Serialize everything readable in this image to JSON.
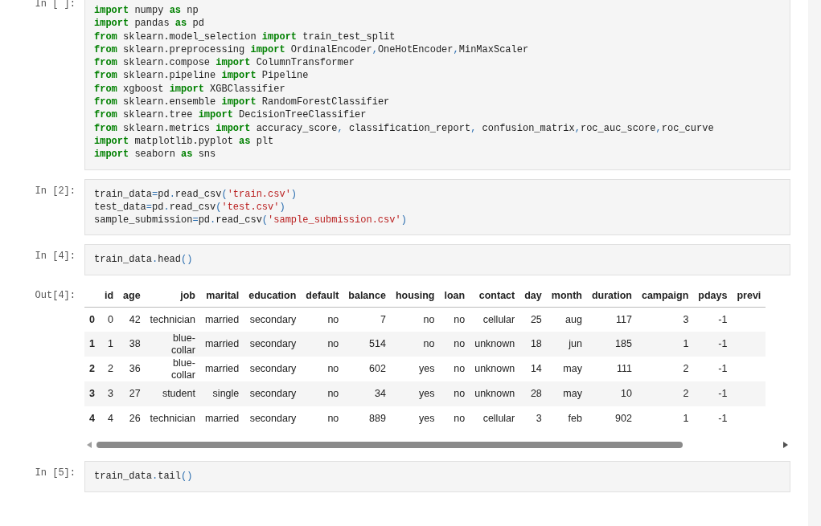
{
  "cells": [
    {
      "prompt": "In [ ]:",
      "lines": [
        [
          {
            "kind": "kw",
            "text": "import"
          },
          {
            "kind": "plain",
            "text": " numpy "
          },
          {
            "kind": "kw",
            "text": "as"
          },
          {
            "kind": "plain",
            "text": " np"
          }
        ],
        [
          {
            "kind": "kw",
            "text": "import"
          },
          {
            "kind": "plain",
            "text": " pandas "
          },
          {
            "kind": "kw",
            "text": "as"
          },
          {
            "kind": "plain",
            "text": " pd"
          }
        ],
        [
          {
            "kind": "kw",
            "text": "from"
          },
          {
            "kind": "plain",
            "text": " sklearn.model_selection "
          },
          {
            "kind": "kw",
            "text": "import"
          },
          {
            "kind": "plain",
            "text": " train_test_split"
          }
        ],
        [
          {
            "kind": "kw",
            "text": "from"
          },
          {
            "kind": "plain",
            "text": " sklearn.preprocessing "
          },
          {
            "kind": "kw",
            "text": "import"
          },
          {
            "kind": "plain",
            "text": " OrdinalEncoder"
          },
          {
            "kind": "op",
            "text": ","
          },
          {
            "kind": "plain",
            "text": "OneHotEncoder"
          },
          {
            "kind": "op",
            "text": ","
          },
          {
            "kind": "plain",
            "text": "MinMaxScaler"
          }
        ],
        [
          {
            "kind": "kw",
            "text": "from"
          },
          {
            "kind": "plain",
            "text": " sklearn.compose "
          },
          {
            "kind": "kw",
            "text": "import"
          },
          {
            "kind": "plain",
            "text": " ColumnTransformer"
          }
        ],
        [
          {
            "kind": "kw",
            "text": "from"
          },
          {
            "kind": "plain",
            "text": " sklearn.pipeline "
          },
          {
            "kind": "kw",
            "text": "import"
          },
          {
            "kind": "plain",
            "text": " Pipeline"
          }
        ],
        [
          {
            "kind": "kw",
            "text": "from"
          },
          {
            "kind": "plain",
            "text": " xgboost "
          },
          {
            "kind": "kw",
            "text": "import"
          },
          {
            "kind": "plain",
            "text": " XGBClassifier"
          }
        ],
        [
          {
            "kind": "kw",
            "text": "from"
          },
          {
            "kind": "plain",
            "text": " sklearn.ensemble "
          },
          {
            "kind": "kw",
            "text": "import"
          },
          {
            "kind": "plain",
            "text": " RandomForestClassifier"
          }
        ],
        [
          {
            "kind": "kw",
            "text": "from"
          },
          {
            "kind": "plain",
            "text": " sklearn.tree "
          },
          {
            "kind": "kw",
            "text": "import"
          },
          {
            "kind": "plain",
            "text": " DecisionTreeClassifier"
          }
        ],
        [
          {
            "kind": "kw",
            "text": "from"
          },
          {
            "kind": "plain",
            "text": " sklearn.metrics "
          },
          {
            "kind": "kw",
            "text": "import"
          },
          {
            "kind": "plain",
            "text": " accuracy_score"
          },
          {
            "kind": "op",
            "text": ","
          },
          {
            "kind": "plain",
            "text": " classification_report"
          },
          {
            "kind": "op",
            "text": ","
          },
          {
            "kind": "plain",
            "text": " confusion_matrix"
          },
          {
            "kind": "op",
            "text": ","
          },
          {
            "kind": "plain",
            "text": "roc_auc_score"
          },
          {
            "kind": "op",
            "text": ","
          },
          {
            "kind": "plain",
            "text": "roc_curve"
          }
        ],
        [
          {
            "kind": "kw",
            "text": "import"
          },
          {
            "kind": "plain",
            "text": " matplotlib.pyplot "
          },
          {
            "kind": "kw",
            "text": "as"
          },
          {
            "kind": "plain",
            "text": " plt"
          }
        ],
        [
          {
            "kind": "kw",
            "text": "import"
          },
          {
            "kind": "plain",
            "text": " seaborn "
          },
          {
            "kind": "kw",
            "text": "as"
          },
          {
            "kind": "plain",
            "text": " sns"
          }
        ]
      ]
    },
    {
      "prompt": "In [2]:",
      "lines": [
        [
          {
            "kind": "plain",
            "text": "train_data"
          },
          {
            "kind": "op",
            "text": "="
          },
          {
            "kind": "plain",
            "text": "pd"
          },
          {
            "kind": "op",
            "text": "."
          },
          {
            "kind": "plain",
            "text": "read_csv"
          },
          {
            "kind": "op",
            "text": "("
          },
          {
            "kind": "str",
            "text": "'train.csv'"
          },
          {
            "kind": "op",
            "text": ")"
          }
        ],
        [
          {
            "kind": "plain",
            "text": "test_data"
          },
          {
            "kind": "op",
            "text": "="
          },
          {
            "kind": "plain",
            "text": "pd"
          },
          {
            "kind": "op",
            "text": "."
          },
          {
            "kind": "plain",
            "text": "read_csv"
          },
          {
            "kind": "op",
            "text": "("
          },
          {
            "kind": "str",
            "text": "'test.csv'"
          },
          {
            "kind": "op",
            "text": ")"
          }
        ],
        [
          {
            "kind": "plain",
            "text": "sample_submission"
          },
          {
            "kind": "op",
            "text": "="
          },
          {
            "kind": "plain",
            "text": "pd"
          },
          {
            "kind": "op",
            "text": "."
          },
          {
            "kind": "plain",
            "text": "read_csv"
          },
          {
            "kind": "op",
            "text": "("
          },
          {
            "kind": "str",
            "text": "'sample_submission.csv'"
          },
          {
            "kind": "op",
            "text": ")"
          }
        ]
      ]
    },
    {
      "prompt": "In [4]:",
      "lines": [
        [
          {
            "kind": "plain",
            "text": "train_data"
          },
          {
            "kind": "op",
            "text": "."
          },
          {
            "kind": "plain",
            "text": "head"
          },
          {
            "kind": "op",
            "text": "()"
          }
        ]
      ],
      "output": {
        "prompt": "Out[4]:",
        "table": {
          "columns": [
            "id",
            "age",
            "job",
            "marital",
            "education",
            "default",
            "balance",
            "housing",
            "loan",
            "contact",
            "day",
            "month",
            "duration",
            "campaign",
            "pdays",
            "previ"
          ],
          "rows": [
            {
              "index": "0",
              "cells": [
                "0",
                "42",
                "technician",
                "married",
                "secondary",
                "no",
                "7",
                "no",
                "no",
                "cellular",
                "25",
                "aug",
                "117",
                "3",
                "-1"
              ]
            },
            {
              "index": "1",
              "cells": [
                "1",
                "38",
                "blue-collar",
                "married",
                "secondary",
                "no",
                "514",
                "no",
                "no",
                "unknown",
                "18",
                "jun",
                "185",
                "1",
                "-1"
              ]
            },
            {
              "index": "2",
              "cells": [
                "2",
                "36",
                "blue-collar",
                "married",
                "secondary",
                "no",
                "602",
                "yes",
                "no",
                "unknown",
                "14",
                "may",
                "111",
                "2",
                "-1"
              ]
            },
            {
              "index": "3",
              "cells": [
                "3",
                "27",
                "student",
                "single",
                "secondary",
                "no",
                "34",
                "yes",
                "no",
                "unknown",
                "28",
                "may",
                "10",
                "2",
                "-1"
              ]
            },
            {
              "index": "4",
              "cells": [
                "4",
                "26",
                "technician",
                "married",
                "secondary",
                "no",
                "889",
                "yes",
                "no",
                "cellular",
                "3",
                "feb",
                "902",
                "1",
                "-1"
              ]
            }
          ]
        }
      }
    },
    {
      "prompt": "In [5]:",
      "lines": [
        [
          {
            "kind": "plain",
            "text": "train_data"
          },
          {
            "kind": "op",
            "text": "."
          },
          {
            "kind": "plain",
            "text": "tail"
          },
          {
            "kind": "op",
            "text": "()"
          }
        ]
      ]
    }
  ]
}
